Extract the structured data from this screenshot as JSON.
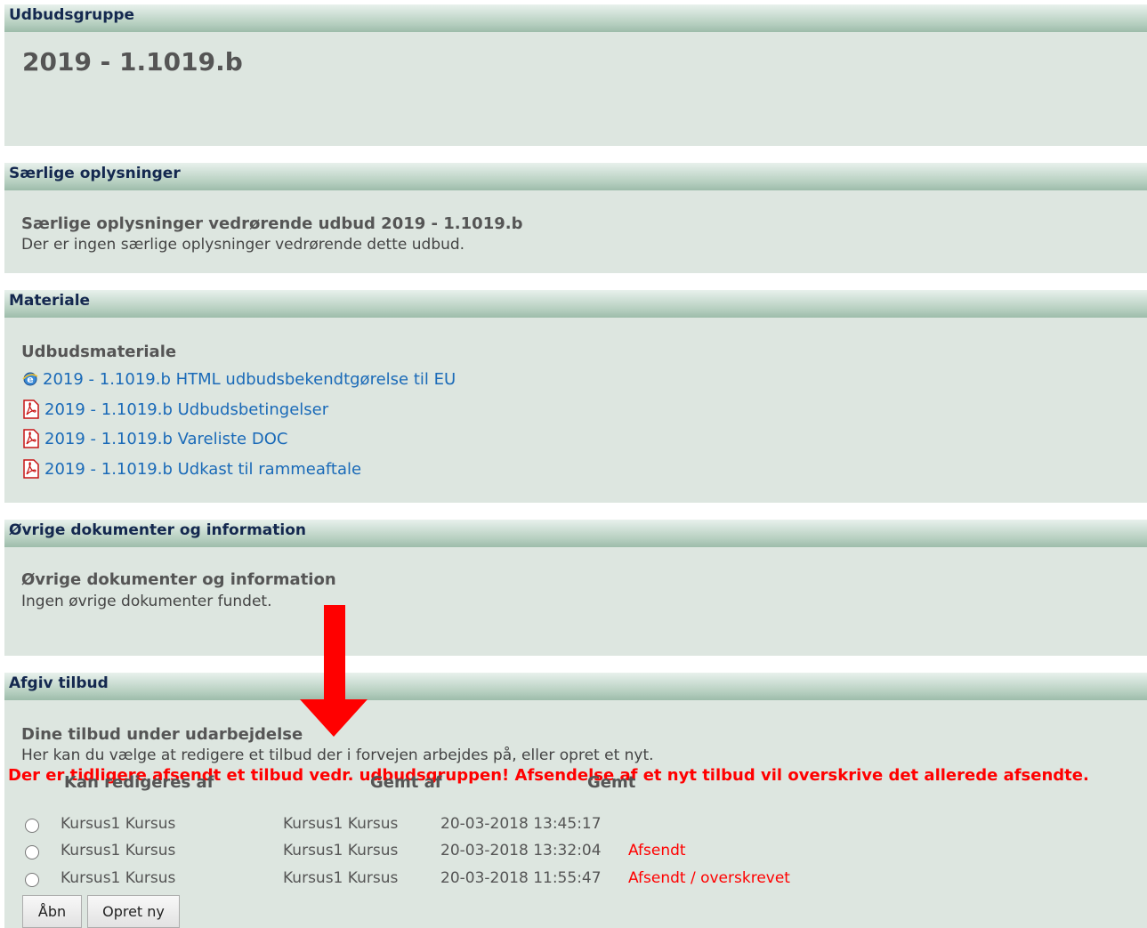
{
  "group": {
    "header": "Udbudsgruppe",
    "title": "2019 - 1.1019.b"
  },
  "special": {
    "header": "Særlige oplysninger",
    "title": "Særlige oplysninger vedrørende udbud 2019 - 1.1019.b",
    "text": "Der er ingen særlige oplysninger vedrørende dette udbud."
  },
  "material": {
    "header": "Materiale",
    "title": "Udbudsmateriale",
    "links": [
      {
        "label": "2019 - 1.1019.b HTML udbudsbekendtgørelse til EU",
        "icon": "ie-icon"
      },
      {
        "label": "2019 - 1.1019.b Udbudsbetingelser",
        "icon": "pdf-icon"
      },
      {
        "label": "2019 - 1.1019.b Vareliste DOC",
        "icon": "pdf-icon"
      },
      {
        "label": "2019 - 1.1019.b Udkast til rammeaftale",
        "icon": "pdf-icon"
      }
    ]
  },
  "other": {
    "header": "Øvrige dokumenter og information",
    "title": "Øvrige dokumenter og information",
    "text": "Ingen øvrige dokumenter fundet."
  },
  "offer": {
    "header": "Afgiv tilbud",
    "title": "Dine tilbud under udarbejdelse",
    "text": "Her kan du vælge at redigere et tilbud der i forvejen arbejdes på, eller opret et nyt.",
    "warning": "Der er tidligere afsendt et tilbud vedr. udbudsgruppen! Afsendelse af et nyt tilbud vil overskrive det allerede afsendte.",
    "columns": [
      "Kan redigeres af",
      "Gemt af",
      "Gemt"
    ],
    "rows": [
      {
        "editable_by": "Kursus1 Kursus",
        "saved_by": "Kursus1 Kursus",
        "saved": "20-03-2018 13:45:17",
        "status": ""
      },
      {
        "editable_by": "Kursus1 Kursus",
        "saved_by": "Kursus1 Kursus",
        "saved": "20-03-2018 13:32:04",
        "status": "Afsendt"
      },
      {
        "editable_by": "Kursus1 Kursus",
        "saved_by": "Kursus1 Kursus",
        "saved": "20-03-2018 11:55:47",
        "status": "Afsendt / overskrevet"
      }
    ],
    "open_button": "Åbn",
    "new_button": "Opret ny"
  },
  "colors": {
    "panel_bg": "#dde6e0",
    "header_text": "#14284f",
    "link": "#1a6ab8",
    "warning": "#ff0000",
    "arrow": "#ff0000"
  }
}
